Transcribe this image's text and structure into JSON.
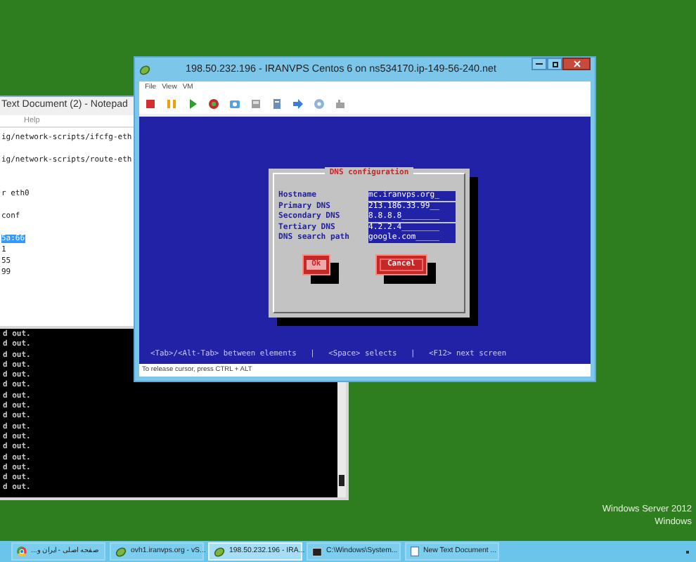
{
  "desktop": {
    "activation_text": [
      "Windows Server 2012",
      "Windows"
    ]
  },
  "notepad": {
    "title": "Text Document (2) - Notepad",
    "menu": [
      "Help"
    ],
    "lines": [
      {
        "kind": "text",
        "text": "ig/network-scripts/ifcfg-eth",
        "selected": false
      },
      {
        "kind": "blank"
      },
      {
        "kind": "text",
        "text": "ig/network-scripts/route-eth",
        "selected": false
      },
      {
        "kind": "blank"
      },
      {
        "kind": "blank"
      },
      {
        "kind": "text",
        "text": "r eth0",
        "selected": false
      },
      {
        "kind": "blank"
      },
      {
        "kind": "text",
        "text": "conf",
        "selected": false
      },
      {
        "kind": "blank"
      },
      {
        "kind": "text",
        "text": "5a:66",
        "selected": true
      },
      {
        "kind": "text",
        "text": "1",
        "selected": false
      },
      {
        "kind": "text",
        "text": "55",
        "selected": false
      },
      {
        "kind": "text",
        "text": "99",
        "selected": false
      }
    ]
  },
  "console": {
    "lines": [
      "d out.",
      "d out.",
      "d out.",
      "d out.",
      "d out.",
      "d out.",
      "d out.",
      "d out.",
      "d out.",
      "d out.",
      "d out.",
      "d out.",
      "d out.",
      "d out.",
      "d out.",
      "d out."
    ]
  },
  "vm_window": {
    "title": "198.50.232.196 - IRANVPS Centos 6 on ns534170.ip-149-56-240.net",
    "menu": [
      "File",
      "View",
      "VM"
    ],
    "dialog": {
      "title": "DNS configuration",
      "fields": [
        {
          "label": "Hostname",
          "value": "mc.iranvps.org_"
        },
        {
          "label": "Primary DNS",
          "value": "213.186.33.99__"
        },
        {
          "label": "Secondary DNS",
          "value": "8.8.8.8________"
        },
        {
          "label": "Tertiary DNS",
          "value": "4.2.2.4________"
        },
        {
          "label": "DNS search path",
          "value": "google.com_____"
        }
      ],
      "buttons": [
        {
          "label": "Ok",
          "focused": true
        },
        {
          "label": "Cancel",
          "focused": false
        }
      ]
    },
    "help_line": "<Tab>/<Alt-Tab> between elements   |   <Space> selects   |   <F12> next screen",
    "status_bar": "To release cursor, press CTRL + ALT"
  },
  "taskbar": {
    "items": [
      {
        "kind": "browser",
        "label": "صفحه اصلی - ایران و...",
        "selected": false
      },
      {
        "kind": "vm",
        "label": "ovh1.iranvps.org - vS...",
        "selected": false
      },
      {
        "kind": "vm",
        "label": "198.50.232.196 - IRA...",
        "selected": true
      },
      {
        "kind": "console",
        "label": "C:\\Windows\\System...",
        "selected": false
      },
      {
        "kind": "notepad",
        "label": "New Text Document ...",
        "selected": false
      }
    ]
  }
}
